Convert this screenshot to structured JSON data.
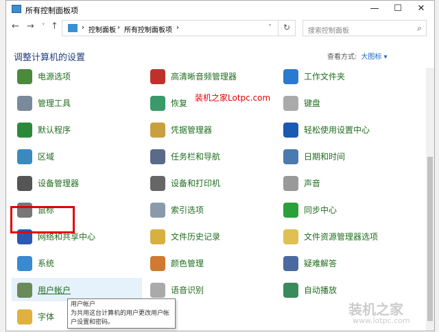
{
  "window": {
    "title": "所有控制面板项",
    "minimize": "—",
    "maximize": "☐",
    "close": "✕"
  },
  "nav": {
    "back": "←",
    "forward": "→",
    "recent": "˅",
    "up": "↑"
  },
  "address": {
    "crumbs": [
      "控制面板",
      "所有控制面板项"
    ],
    "sep": "›",
    "dropdown": "˅",
    "refresh": "↻"
  },
  "search": {
    "placeholder": "搜索控制面板",
    "icon": "⌕"
  },
  "heading": "调整计算机的设置",
  "view": {
    "label": "查看方式:",
    "value": "大图标 ▾"
  },
  "items": [
    {
      "label": "电源选项",
      "color": "#4a8a3a"
    },
    {
      "label": "高清晰音频管理器",
      "color": "#c0302a"
    },
    {
      "label": "工作文件夹",
      "color": "#2a7ad0"
    },
    {
      "label": "管理工具",
      "color": "#7a8a9a"
    },
    {
      "label": "恢复",
      "color": "#3a9a6a"
    },
    {
      "label": "键盘",
      "color": "#aaaaaa"
    },
    {
      "label": "默认程序",
      "color": "#2a8a3a"
    },
    {
      "label": "凭据管理器",
      "color": "#c8a040"
    },
    {
      "label": "轻松使用设置中心",
      "color": "#1a5ab0"
    },
    {
      "label": "区域",
      "color": "#3a8ac0"
    },
    {
      "label": "任务栏和导航",
      "color": "#5a6a8a"
    },
    {
      "label": "日期和时间",
      "color": "#4a7ab0"
    },
    {
      "label": "设备管理器",
      "color": "#555555"
    },
    {
      "label": "设备和打印机",
      "color": "#666666"
    },
    {
      "label": "声音",
      "color": "#999999"
    },
    {
      "label": "鼠标",
      "color": "#777777"
    },
    {
      "label": "索引选项",
      "color": "#8a9aaa"
    },
    {
      "label": "同步中心",
      "color": "#2aa03a"
    },
    {
      "label": "网络和共享中心",
      "color": "#2a5ab0"
    },
    {
      "label": "文件历史记录",
      "color": "#d8b040"
    },
    {
      "label": "文件资源管理器选项",
      "color": "#e0c050"
    },
    {
      "label": "系统",
      "color": "#3a8ad0"
    },
    {
      "label": "颜色管理",
      "color": "#d07a30"
    },
    {
      "label": "疑难解答",
      "color": "#4a6aa0"
    },
    {
      "label": "用户帐户",
      "color": "#6a8a5a"
    },
    {
      "label": "语音识别",
      "color": "#aaaaaa"
    },
    {
      "label": "自动播放",
      "color": "#3a8a5a"
    },
    {
      "label": "字体",
      "color": "#e0b040"
    }
  ],
  "tooltip": {
    "title": "用户帐户",
    "text": "为共用这台计算机的用户更改用户帐户设置和密码。"
  },
  "watermark": {
    "site": "装机之家Lotpc.com",
    "logo": "装机之家",
    "url": "www.lotpc.com"
  }
}
